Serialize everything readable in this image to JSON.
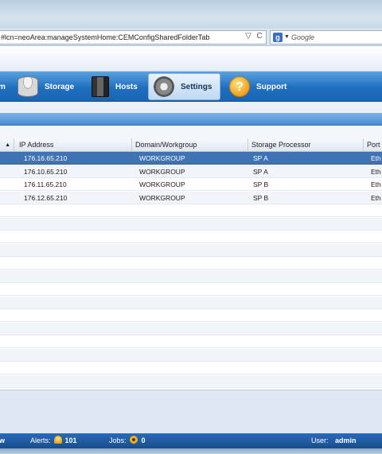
{
  "browser": {
    "url": "#lcn=neoArea:manageSystemHome:CEMConfigSharedFolderTab",
    "dropdown_glyph": "▽",
    "reload_glyph": "C",
    "search_placeholder": "Google",
    "search_engine_letter": "g",
    "search_dropdown_glyph": "▼"
  },
  "nav": {
    "items": [
      {
        "label": "m",
        "icon": "system-icon"
      },
      {
        "label": "Storage",
        "icon": "storage-icon"
      },
      {
        "label": "Hosts",
        "icon": "hosts-icon"
      },
      {
        "label": "Settings",
        "icon": "gear-icon",
        "active": true
      },
      {
        "label": "Support",
        "icon": "support-icon"
      }
    ],
    "support_glyph": "?"
  },
  "grid": {
    "sort_indicator": "▲",
    "columns": [
      "IP Address",
      "Domain/Workgroup",
      "Storage Processor",
      "Port"
    ],
    "rows": [
      {
        "ip": "176.16.65.210",
        "domain": "WORKGROUP",
        "sp": "SP A",
        "port": "Eth"
      },
      {
        "ip": "176.10.65.210",
        "domain": "WORKGROUP",
        "sp": "SP A",
        "port": "Eth"
      },
      {
        "ip": "176.11.65.210",
        "domain": "WORKGROUP",
        "sp": "SP B",
        "port": "Eth"
      },
      {
        "ip": "176.12.65.210",
        "domain": "WORKGROUP",
        "sp": "SP B",
        "port": "Eth"
      }
    ],
    "selected_row": 0
  },
  "status": {
    "left_fragment": "w",
    "alerts_label": "Alerts:",
    "alerts_count": "101",
    "jobs_label": "Jobs:",
    "jobs_count": "0",
    "user_label": "User:",
    "user_name": "admin"
  },
  "colors": {
    "nav_blue": "#1f6fc0",
    "selected_row": "#3f73b3",
    "status_bar": "#174e8f"
  }
}
